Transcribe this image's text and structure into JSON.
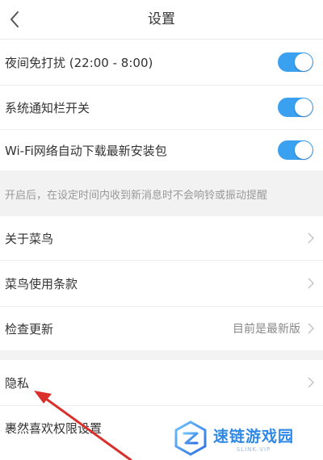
{
  "header": {
    "title": "设置"
  },
  "toggles": [
    {
      "label": "夜间免打扰 (22:00 - 8:00)",
      "on": true
    },
    {
      "label": "系统通知栏开关",
      "on": true
    },
    {
      "label": "Wi-Fi网络自动下载最新安装包",
      "on": true
    }
  ],
  "hint": "开启后，在设定时间内收到新消息时不会响铃或振动提醒",
  "menu_group_1": [
    {
      "label": "关于菜鸟",
      "value": ""
    },
    {
      "label": "菜鸟使用条款",
      "value": ""
    },
    {
      "label": "检查更新",
      "value": "目前是最新版"
    }
  ],
  "menu_group_2": [
    {
      "label": "隐私",
      "value": ""
    },
    {
      "label": "裹然喜欢权限设置",
      "value": ""
    }
  ],
  "colors": {
    "toggle_on": "#3aa0f0",
    "annotation_arrow": "#d9302c",
    "watermark_blue": "#2f88e6"
  },
  "watermark": {
    "text": "速链游戏园",
    "sub": "SLINK.VIP"
  }
}
